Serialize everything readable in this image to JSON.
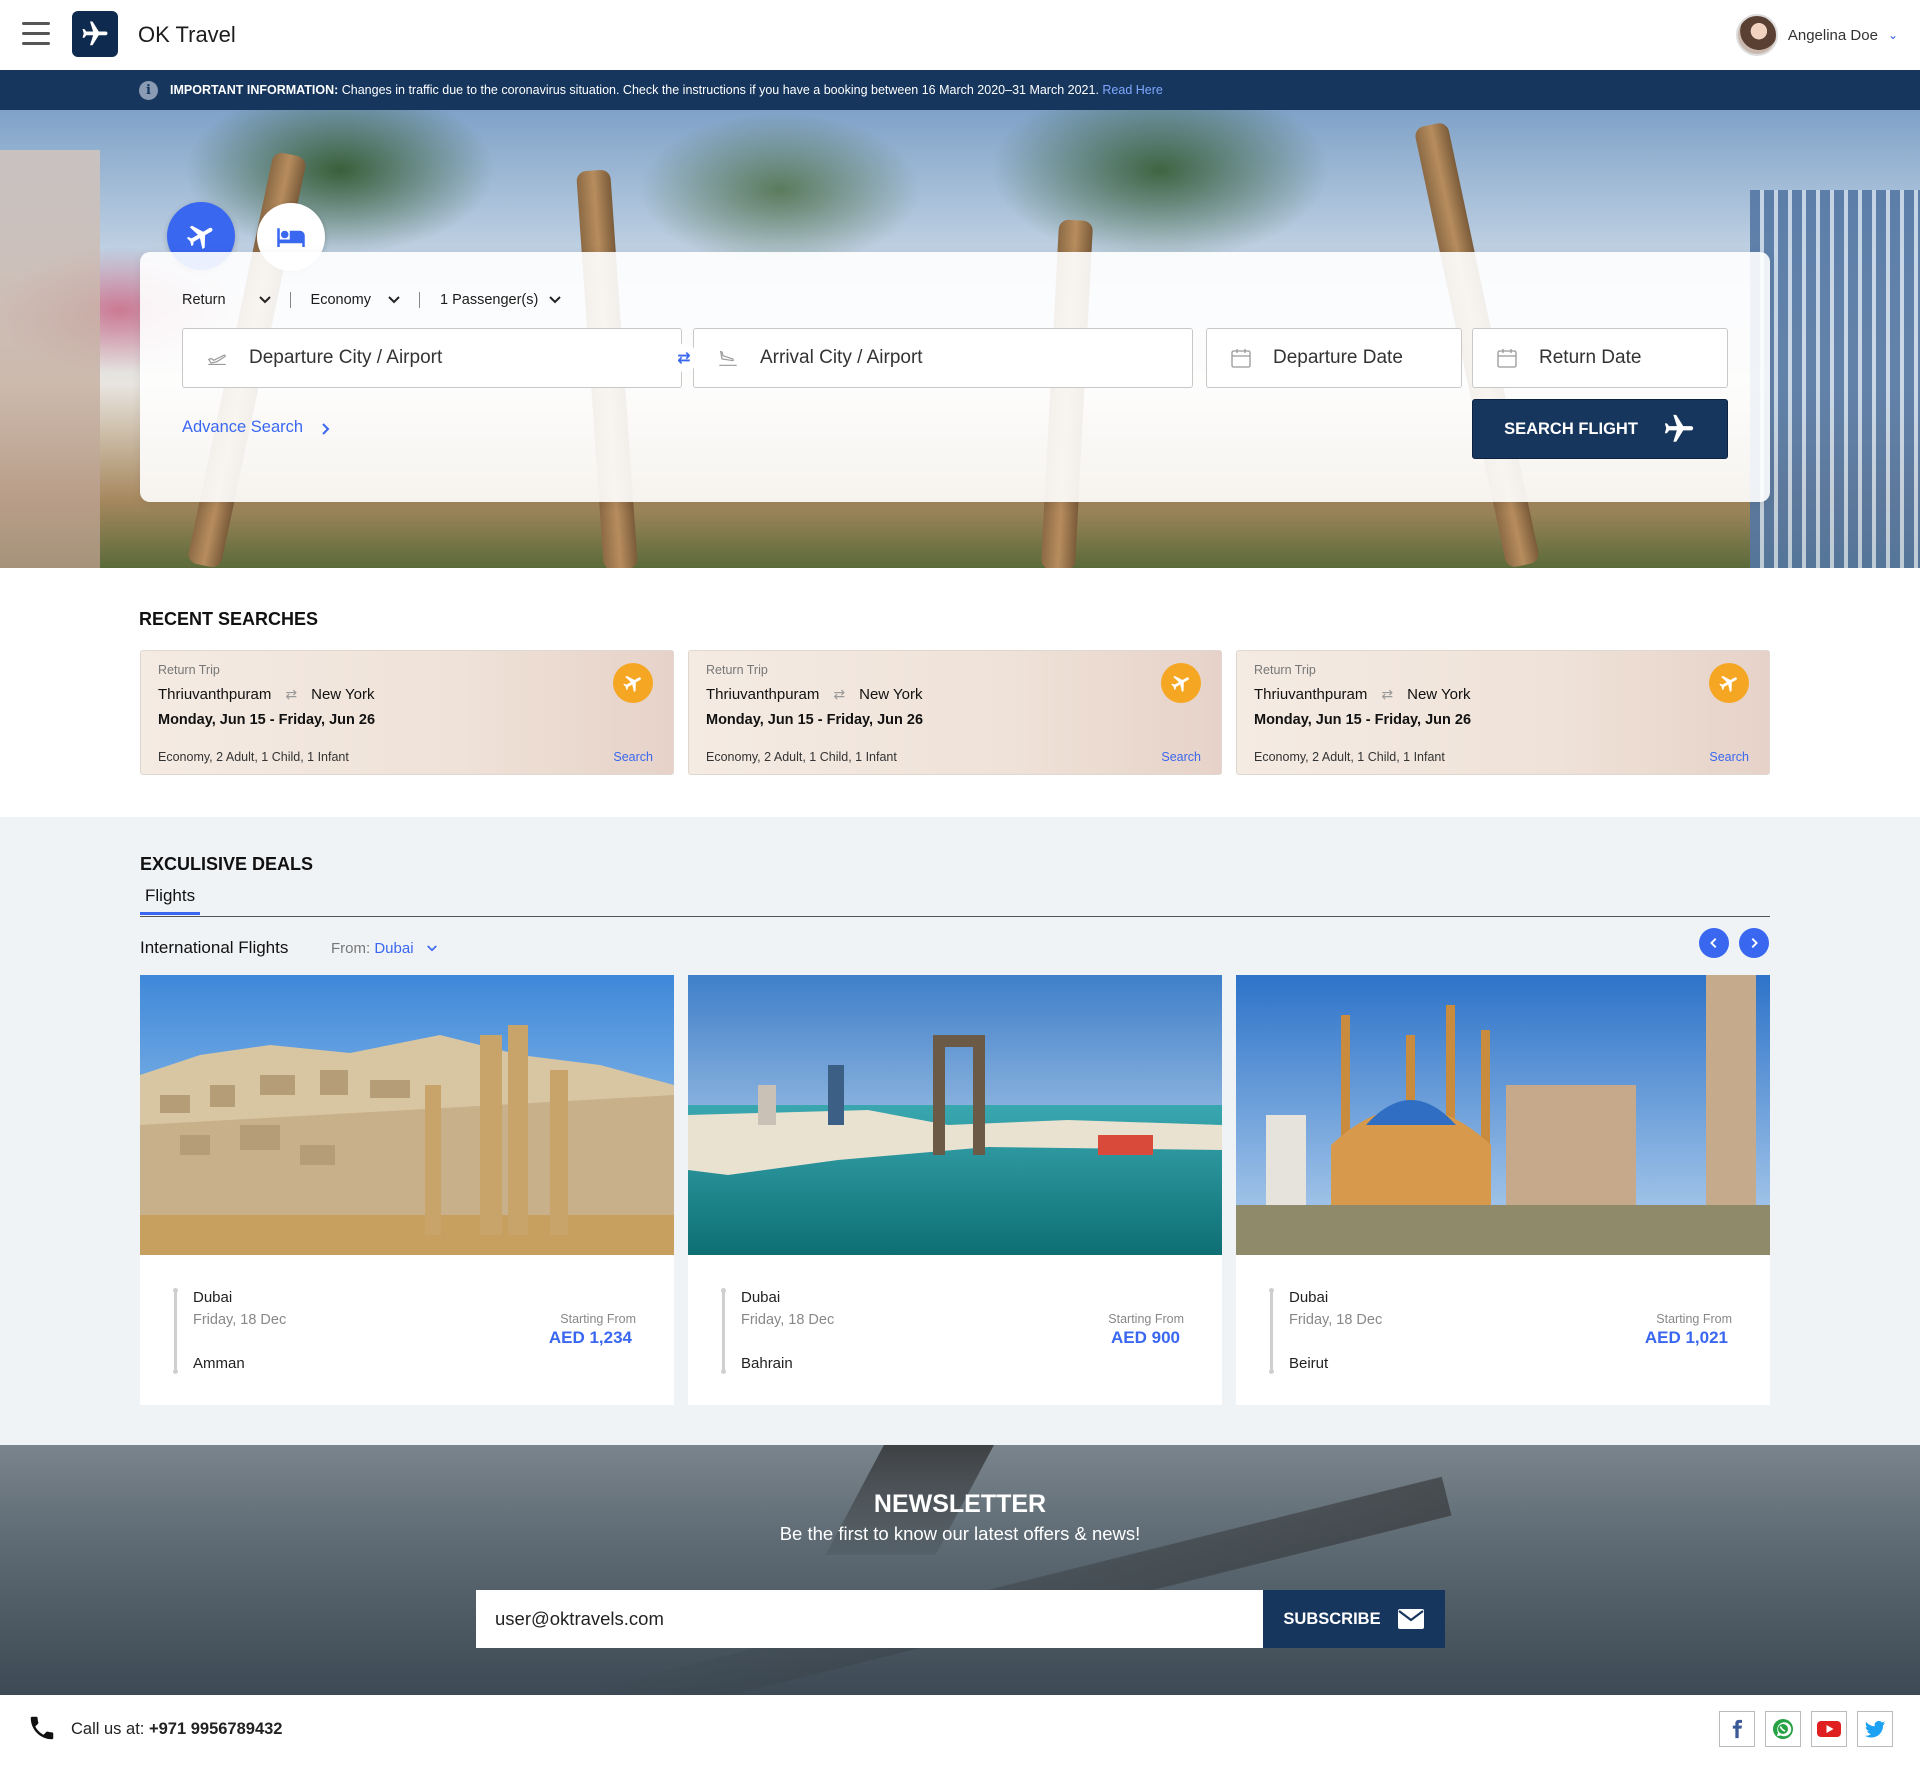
{
  "header": {
    "brand": "OK Travel",
    "user_name": "Angelina Doe"
  },
  "info": {
    "label": "IMPORTANT INFORMATION:",
    "text": "Changes in traffic due to the coronavirus situation. Check the instructions if you have a booking between 16 March 2020–31 March 2021.",
    "link": "Read Here"
  },
  "search": {
    "trip_type": "Return",
    "cabin": "Economy",
    "passengers": "1 Passenger(s)",
    "departure_placeholder": "Departure City / Airport",
    "arrival_placeholder": "Arrival City / Airport",
    "departure_date_placeholder": "Departure Date",
    "return_date_placeholder": "Return Date",
    "advance_search": "Advance Search",
    "search_button": "SEARCH FLIGHT"
  },
  "recent": {
    "title": "RECENT SEARCHES",
    "items": [
      {
        "type": "Return Trip",
        "from": "Thriuvanthpuram",
        "to": "New York",
        "dates": "Monday, Jun 15 - Friday, Jun 26",
        "meta": "Economy, 2 Adult, 1 Child, 1 Infant",
        "action": "Search"
      },
      {
        "type": "Return Trip",
        "from": "Thriuvanthpuram",
        "to": "New York",
        "dates": "Monday, Jun 15 - Friday, Jun 26",
        "meta": "Economy, 2 Adult, 1 Child, 1 Infant",
        "action": "Search"
      },
      {
        "type": "Return Trip",
        "from": "Thriuvanthpuram",
        "to": "New York",
        "dates": "Monday, Jun 15 - Friday, Jun 26",
        "meta": "Economy, 2 Adult, 1 Child, 1 Infant",
        "action": "Search"
      }
    ]
  },
  "deals": {
    "title": "EXCULISIVE DEALS",
    "tab": "Flights",
    "subtitle": "International Flights",
    "from_label": "From:",
    "from_city": "Dubai",
    "items": [
      {
        "from": "Dubai",
        "date": "Friday, 18 Dec",
        "to": "Amman",
        "price_label": "Starting From",
        "price": "AED 1,234"
      },
      {
        "from": "Dubai",
        "date": "Friday, 18 Dec",
        "to": "Bahrain",
        "price_label": "Starting From",
        "price": "AED 900"
      },
      {
        "from": "Dubai",
        "date": "Friday, 18 Dec",
        "to": "Beirut",
        "price_label": "Starting From",
        "price": "AED 1,021"
      }
    ]
  },
  "newsletter": {
    "title": "NEWSLETTER",
    "subtitle": "Be the first to know our latest offers & news!",
    "email_value": "user@oktravels.com",
    "button": "SUBSCRIBE"
  },
  "footer": {
    "call_label": "Call us at:",
    "phone": "+971 9956789432"
  },
  "colors": {
    "navy": "#16365e",
    "accent_blue": "#3a67f0",
    "badge_orange": "#f5a623"
  }
}
